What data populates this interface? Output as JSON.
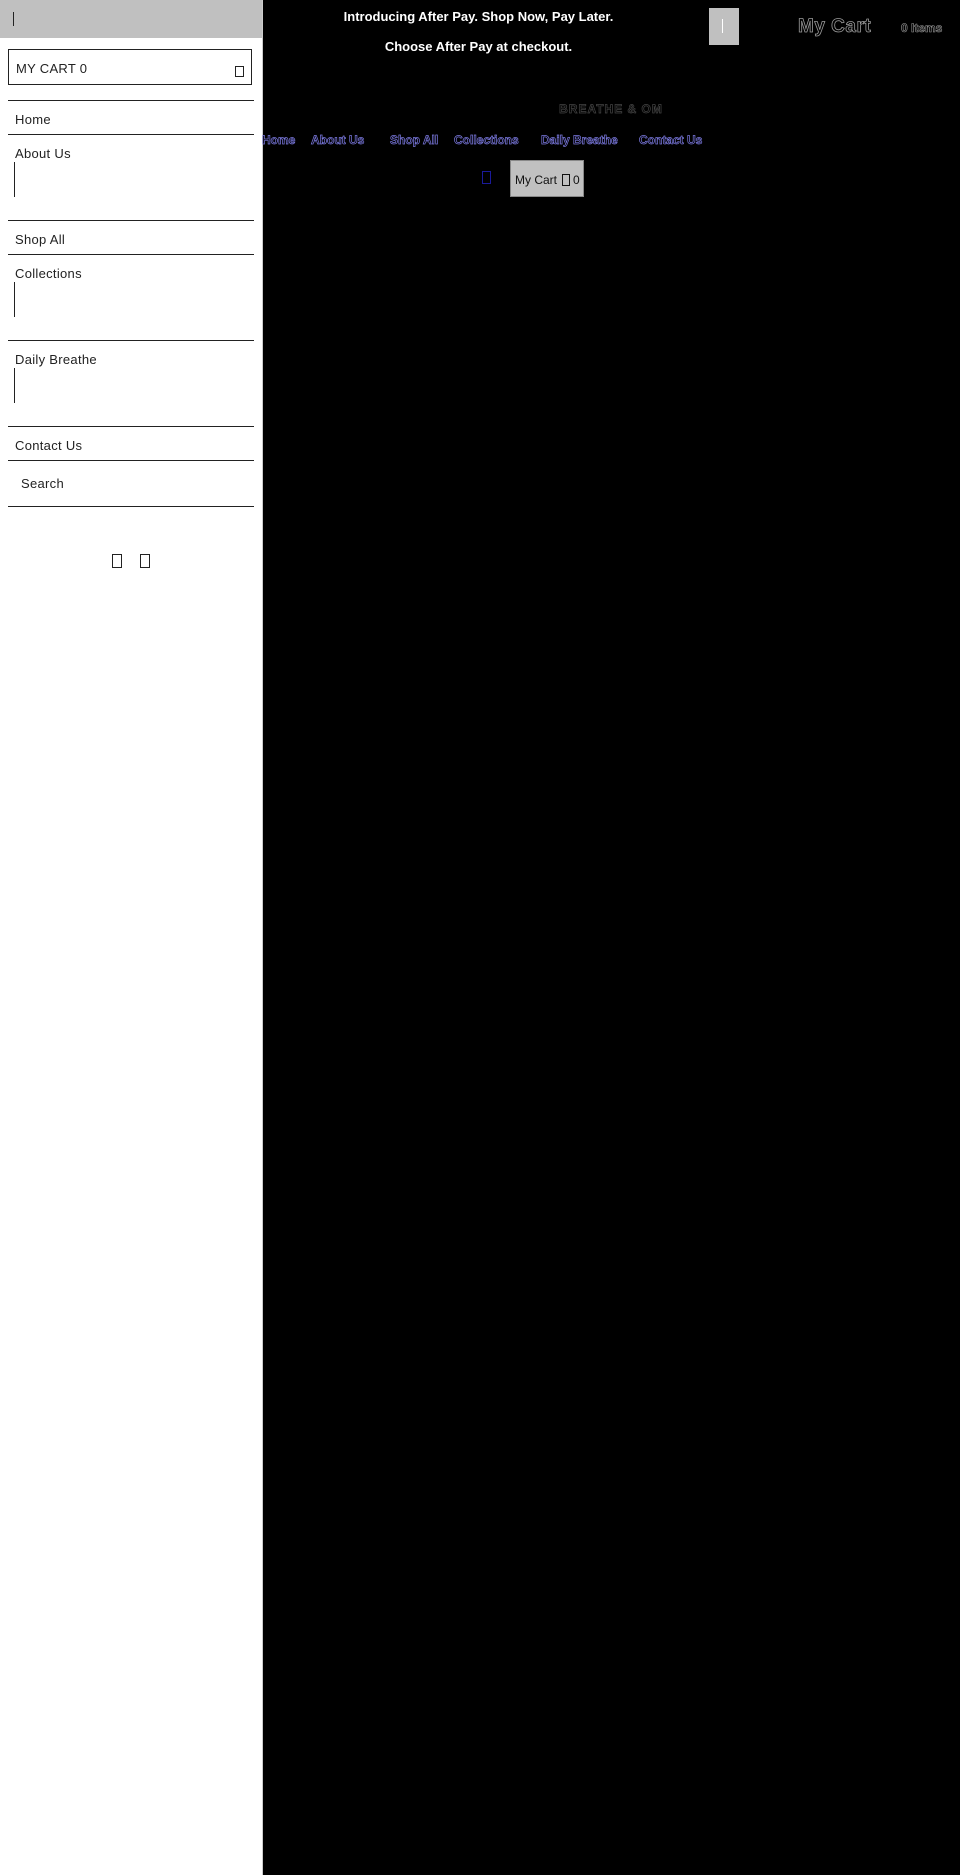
{
  "announcement": {
    "line1": "Introducing After Pay. Shop Now, Pay Later.",
    "line2": "Choose After Pay at checkout."
  },
  "header": {
    "cart_title": "My Cart",
    "item_count": "0 Items",
    "brand": "BREATHE & OM",
    "nav": [
      "Home",
      "About Us",
      "Shop All",
      "Collections",
      "Daily Breathe",
      "Contact Us"
    ],
    "cart_button": {
      "label": "My Cart",
      "count": "0"
    }
  },
  "drawer": {
    "cart_label": "MY CART 0",
    "items": [
      {
        "label": "Home"
      },
      {
        "label": "About Us"
      },
      {
        "label": "Shop All"
      },
      {
        "label": "Collections"
      },
      {
        "label": "Daily Breathe"
      },
      {
        "label": "Contact Us"
      }
    ],
    "search_label": "Search"
  },
  "icons": {
    "close": "close-icon",
    "bag": "bag-icon",
    "search": "search-icon",
    "social1": "facebook-icon",
    "social2": "instagram-icon"
  },
  "colors": {
    "background": "#000000",
    "drawer": "#ffffff",
    "drawer_top": "#c0c0c0",
    "nav_link_outline": "#7b79e0"
  }
}
